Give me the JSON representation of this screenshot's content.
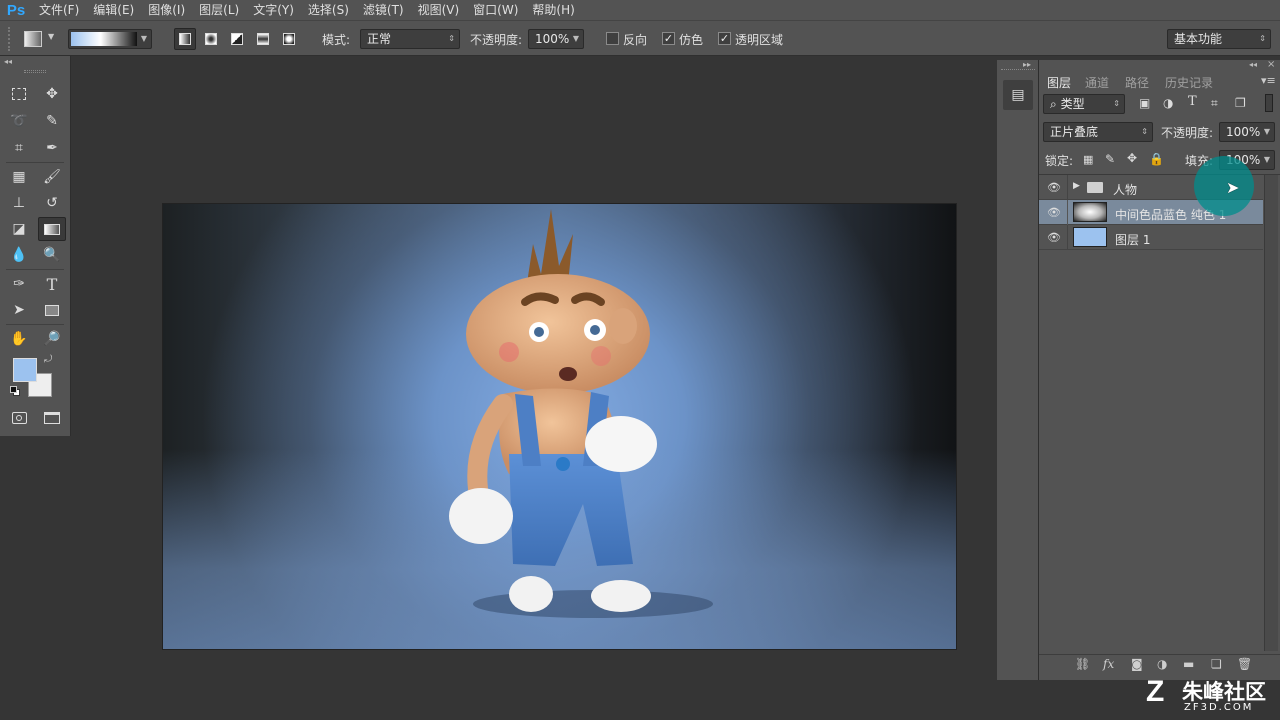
{
  "app": {
    "logo": "Ps"
  },
  "menu": [
    "文件(F)",
    "编辑(E)",
    "图像(I)",
    "图层(L)",
    "文字(Y)",
    "选择(S)",
    "滤镜(T)",
    "视图(V)",
    "窗口(W)",
    "帮助(H)"
  ],
  "options": {
    "mode_label": "模式:",
    "mode_value": "正常",
    "opacity_label": "不透明度:",
    "opacity_value": "100%",
    "reverse_label": "反向",
    "dither_label": "仿色",
    "transparency_label": "透明区域",
    "workspace_value": "基本功能"
  },
  "layers_panel": {
    "tabs": [
      "图层",
      "通道",
      "路径",
      "历史记录"
    ],
    "filter_value": "类型",
    "blend_mode": "正片叠底",
    "opacity_label": "不透明度:",
    "opacity_value": "100%",
    "lock_label": "锁定:",
    "fill_label": "填充:",
    "fill_value": "100%",
    "layers": [
      {
        "name": "人物",
        "type": "group",
        "selected": false
      },
      {
        "name": "中间色品蓝色 纯色 1",
        "type": "gradient",
        "selected": true
      },
      {
        "name": "图层 1",
        "type": "fill",
        "selected": false
      }
    ],
    "bottom_icons": {
      "fx": "fx"
    }
  },
  "colors": {
    "foreground": "#9cc2ef",
    "background": "#eeeeee",
    "selection": "#7a8a9c"
  },
  "watermark": {
    "brand": "朱峰社区",
    "domain": "ZF3D.COM"
  }
}
